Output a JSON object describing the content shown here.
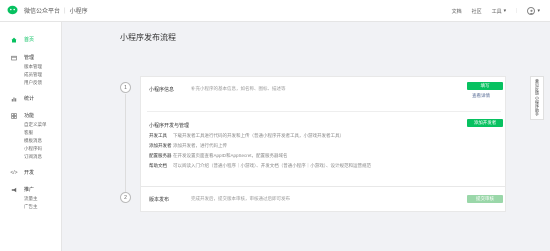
{
  "header": {
    "brand": "微信公众平台",
    "section": "小程序",
    "nav": [
      "文档",
      "社区",
      "工具"
    ]
  },
  "sidebar": {
    "groups": [
      {
        "label": "首页",
        "icon": "home-icon",
        "active": true,
        "items": []
      },
      {
        "label": "管理",
        "icon": "folder-icon",
        "active": false,
        "items": [
          "版本管理",
          "成员管理",
          "用户反馈"
        ]
      },
      {
        "label": "统计",
        "icon": "stats-icon",
        "active": false,
        "items": []
      },
      {
        "label": "功能",
        "icon": "function-icon",
        "active": false,
        "items": [
          "自定义菜单",
          "客服",
          "模板消息",
          "小程序码",
          "订阅消息"
        ]
      },
      {
        "label": "开发",
        "icon": "code-icon",
        "active": false,
        "items": []
      },
      {
        "label": "推广",
        "icon": "promotion-icon",
        "active": false,
        "items": [
          "流量主",
          "广告主"
        ]
      }
    ]
  },
  "main": {
    "title": "小程序发布流程",
    "step1": {
      "num": "1",
      "label": "小程序信息",
      "desc": "补充小程序的基本信息，如名称、图标、描述等",
      "button": "填写",
      "link": "查看详情",
      "dev_title": "小程序开发与管理",
      "dev_button": "添加开发者",
      "dev_rows": [
        {
          "k": "开发工具",
          "v": "下载开发者工具进行代码的开发和上传（普通小程序开发者工具，小游戏开发者工具）"
        },
        {
          "k": "添加开发者",
          "v": "添加开发者，进行代码上传"
        },
        {
          "k": "配置服务器",
          "v": "在开发设置页面查看AppID和AppSecret，配置服务器域名"
        },
        {
          "k": "帮助文档",
          "v": "可以阅读入门介绍（普通小程序｜小游戏）、开发文档（普通小程序｜小游戏）、设计规范和运营规范"
        }
      ]
    },
    "step2": {
      "num": "2",
      "label": "版本发布",
      "desc": "完成开发后，提交版本审核，审核通过后即可发布",
      "button": "提交审核"
    }
  },
  "float_panel": {
    "label": "意见反馈 小程序助手"
  }
}
